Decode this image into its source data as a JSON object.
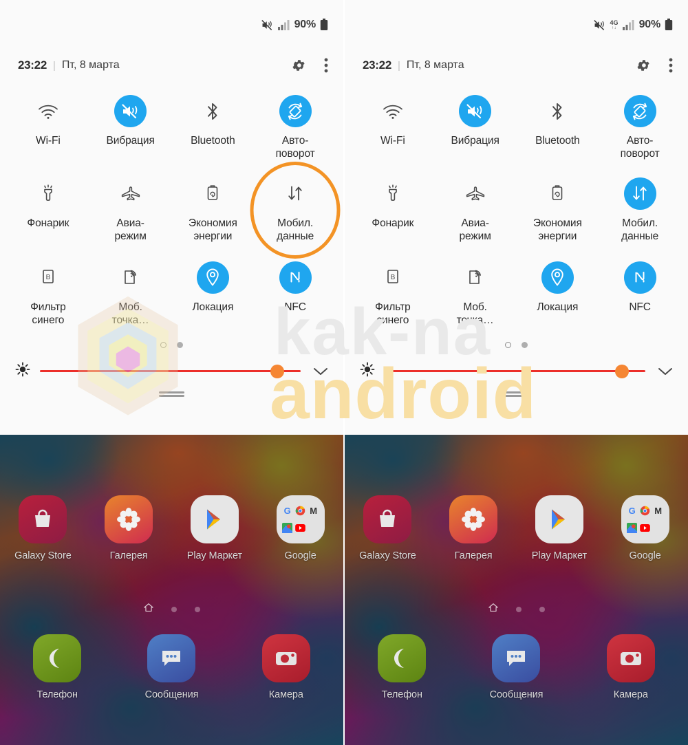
{
  "status_bar": {
    "battery_percent": "90%",
    "network_label": "4G",
    "icons": [
      "mute-vibrate-icon",
      "signal-icon",
      "battery-icon"
    ]
  },
  "header": {
    "time": "23:22",
    "separator": "|",
    "date": "Пт, 8 марта",
    "settings_icon": "gear-icon",
    "more_icon": "more-vertical-icon"
  },
  "quick_settings": {
    "left_panel": {
      "tiles": [
        {
          "label": "Wi-Fi",
          "icon": "wifi-icon",
          "active": false
        },
        {
          "label": "Вибрация",
          "icon": "vibrate-icon",
          "active": true
        },
        {
          "label": "Bluetooth",
          "icon": "bluetooth-icon",
          "active": false
        },
        {
          "label": "Авто-\nповорот",
          "icon": "auto-rotate-icon",
          "active": true
        },
        {
          "label": "Фонарик",
          "icon": "flashlight-icon",
          "active": false
        },
        {
          "label": "Авиа-\nрежим",
          "icon": "airplane-icon",
          "active": false
        },
        {
          "label": "Экономия\nэнергии",
          "icon": "power-saving-icon",
          "active": false
        },
        {
          "label": "Мобил.\nданные",
          "icon": "mobile-data-icon",
          "active": false,
          "highlighted": true
        },
        {
          "label": "Фильтр\nсинего",
          "icon": "blue-light-filter-icon",
          "active": false
        },
        {
          "label": "Моб.\nточка…",
          "icon": "hotspot-icon",
          "active": false
        },
        {
          "label": "Локация",
          "icon": "location-icon",
          "active": true
        },
        {
          "label": "NFC",
          "icon": "nfc-icon",
          "active": true
        }
      ]
    },
    "right_panel": {
      "tiles": [
        {
          "label": "Wi-Fi",
          "icon": "wifi-icon",
          "active": false
        },
        {
          "label": "Вибрация",
          "icon": "vibrate-icon",
          "active": true
        },
        {
          "label": "Bluetooth",
          "icon": "bluetooth-icon",
          "active": false
        },
        {
          "label": "Авто-\nповорот",
          "icon": "auto-rotate-icon",
          "active": true
        },
        {
          "label": "Фонарик",
          "icon": "flashlight-icon",
          "active": false
        },
        {
          "label": "Авиа-\nрежим",
          "icon": "airplane-icon",
          "active": false
        },
        {
          "label": "Экономия\nэнергии",
          "icon": "power-saving-icon",
          "active": false
        },
        {
          "label": "Мобил.\nданные",
          "icon": "mobile-data-icon",
          "active": true
        },
        {
          "label": "Фильтр\nсинего",
          "icon": "blue-light-filter-icon",
          "active": false
        },
        {
          "label": "Моб.\nточка…",
          "icon": "hotspot-icon",
          "active": false
        },
        {
          "label": "Локация",
          "icon": "location-icon",
          "active": true
        },
        {
          "label": "NFC",
          "icon": "nfc-icon",
          "active": true
        }
      ]
    },
    "page_dots": {
      "count": 2,
      "active_index": 0
    },
    "brightness": {
      "icon": "brightness-icon",
      "value_percent": 91,
      "expand_icon": "chevron-down-icon",
      "track_color": "#ec2f2a",
      "knob_color": "#f58633"
    },
    "highlight_color": "#f39325",
    "accent_color": "#1fa6ef"
  },
  "home_screen": {
    "apps": [
      {
        "label": "Galaxy Store",
        "icon": "galaxy-store-icon"
      },
      {
        "label": "Галерея",
        "icon": "gallery-icon"
      },
      {
        "label": "Play Маркет",
        "icon": "play-store-icon"
      },
      {
        "label": "Google",
        "icon": "google-folder-icon"
      }
    ],
    "dock": [
      {
        "label": "Телефон",
        "icon": "phone-icon"
      },
      {
        "label": "Сообщения",
        "icon": "messages-icon"
      },
      {
        "label": "Камера",
        "icon": "camera-icon"
      }
    ],
    "page_indicator": {
      "home_icon": "home-icon",
      "dots": 2
    }
  },
  "watermark": {
    "line1": "kak-na",
    "line2": "android"
  }
}
